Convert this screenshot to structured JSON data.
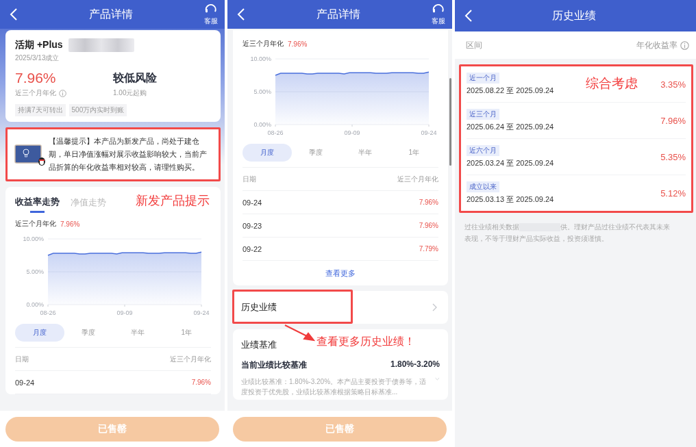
{
  "detail_screen": {
    "header": {
      "title": "产品详情",
      "service_label": "客服"
    },
    "product": {
      "name": "活期 +Plus",
      "established": "2025/3/13成立",
      "rate": "7.96%",
      "rate_label": "近三个月年化",
      "risk": "较低风险",
      "min_purchase": "1.00元起购",
      "tags": [
        "持满7天可转出",
        "500万内实时到账"
      ]
    },
    "notice": {
      "text": "【温馨提示】本产品为新发产品，尚处于建仓期，单日净值涨幅对展示收益影响较大，当前产品折算的年化收益率相对较高，请理性购买。"
    },
    "annotation": {
      "text": "新发产品提示"
    },
    "trend": {
      "tabs": [
        {
          "label": "收益率走势",
          "selected": true
        },
        {
          "label": "净值走势",
          "selected": false
        }
      ],
      "summary_label": "近三个月年化",
      "summary_value": "7.96%",
      "x_axis_labels": [
        "08-26",
        "09-09",
        "09-24"
      ],
      "chart_data": {
        "type": "line",
        "ylim": [
          0,
          10
        ],
        "yticks": [
          {
            "value": 0,
            "label": "0.00%"
          },
          {
            "value": 5,
            "label": "5.00%"
          },
          {
            "value": 10,
            "label": "10.00%"
          }
        ],
        "series": [
          {
            "color": "#4a6fdc",
            "values": [
              7.5,
              7.8,
              7.8,
              7.8,
              7.8,
              7.8,
              7.7,
              7.7,
              7.8,
              7.8,
              7.8,
              7.8,
              7.8,
              7.7,
              7.9,
              7.9,
              7.9,
              7.9,
              7.9,
              7.8,
              7.8,
              7.8,
              7.9,
              7.9,
              7.9,
              7.9,
              7.9,
              7.8,
              7.8,
              8.0
            ]
          }
        ]
      },
      "periods": [
        {
          "label": "月度",
          "selected": true
        },
        {
          "label": "季度",
          "selected": false
        },
        {
          "label": "半年",
          "selected": false
        },
        {
          "label": "1年",
          "selected": false
        }
      ],
      "table": {
        "columns": [
          "日期",
          "近三个月年化"
        ],
        "rows": [
          {
            "date": "09-24",
            "value": "7.96%"
          }
        ]
      }
    },
    "buy_button": {
      "label": "已售罄",
      "disabled": true
    }
  },
  "scrolled_screen": {
    "header": {
      "title": "产品详情",
      "service_label": "客服"
    },
    "trend": {
      "summary_label": "近三个月年化",
      "summary_value": "7.96%",
      "x_axis_labels": [
        "08-26",
        "09-09",
        "09-24"
      ],
      "chart_data": {
        "type": "line",
        "ylim": [
          0,
          10
        ],
        "yticks": [
          {
            "value": 0,
            "label": "0.00%"
          },
          {
            "value": 5,
            "label": "5.00%"
          },
          {
            "value": 10,
            "label": "10.00%"
          }
        ],
        "series": [
          {
            "color": "#4a6fdc",
            "values": [
              7.5,
              7.8,
              7.8,
              7.8,
              7.8,
              7.8,
              7.7,
              7.7,
              7.8,
              7.8,
              7.8,
              7.8,
              7.8,
              7.7,
              7.9,
              7.9,
              7.9,
              7.9,
              7.9,
              7.8,
              7.8,
              7.8,
              7.9,
              7.9,
              7.9,
              7.9,
              7.9,
              7.8,
              7.8,
              8.0
            ]
          }
        ]
      },
      "periods": [
        {
          "label": "月度",
          "selected": true
        },
        {
          "label": "季度",
          "selected": false
        },
        {
          "label": "半年",
          "selected": false
        },
        {
          "label": "1年",
          "selected": false
        }
      ],
      "table": {
        "columns": [
          "日期",
          "近三个月年化"
        ],
        "rows": [
          {
            "date": "09-24",
            "value": "7.96%"
          },
          {
            "date": "09-23",
            "value": "7.96%"
          },
          {
            "date": "09-22",
            "value": "7.79%"
          }
        ]
      },
      "more_link": "查看更多"
    },
    "history_link": "历史业绩",
    "benchmark": {
      "title": "业绩基准",
      "label": "当前业绩比较基准",
      "value": "1.80%-3.20%",
      "description": "业绩比较基准：1.80%-3.20%。本产品主要投资于债券等，适度投资于优先股，业绩比较基准根据策略目标基准..."
    },
    "annotation": {
      "text": "查看更多历史业绩！"
    },
    "buy_button": {
      "label": "已售罄",
      "disabled": true
    }
  },
  "history_screen": {
    "header": {
      "title": "历史业绩"
    },
    "columns": [
      "区间",
      "年化收益率"
    ],
    "periods": [
      {
        "tag": "近一个月",
        "range": "2025.08.22 至 2025.09.24",
        "rate": "3.35%"
      },
      {
        "tag": "近三个月",
        "range": "2025.06.24 至 2025.09.24",
        "rate": "7.96%"
      },
      {
        "tag": "近六个月",
        "range": "2025.03.24 至 2025.09.24",
        "rate": "5.35%"
      },
      {
        "tag": "成立以来",
        "range": "2025.03.13 至 2025.09.24",
        "rate": "5.12%"
      }
    ],
    "annotation": {
      "text": "综合考虑"
    },
    "footnote_start": "过往业绩相关数据",
    "footnote_middle": "供。理财产品过往业绩不代表其未来",
    "footnote_end": "表现，不等于理财产品实际收益，投资须谨慎。"
  }
}
